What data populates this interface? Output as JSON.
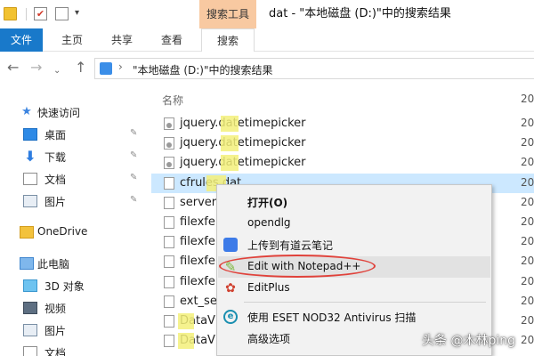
{
  "titlebar": {
    "context_tab": "搜索工具",
    "title": "dat - \"本地磁盘 (D:)\"中的搜索结果",
    "qa_check_glyph": "✔",
    "qa_more_glyph": "▾"
  },
  "ribbon": {
    "tabs": [
      "文件",
      "主页",
      "共享",
      "查看",
      "搜索"
    ]
  },
  "address": {
    "path": "\"本地磁盘 (D:)\"中的搜索结果",
    "nav_back_glyph": "←",
    "nav_forward_glyph": "→",
    "nav_history_glyph": "⌄",
    "nav_up_glyph": "↑",
    "chevron_glyph": "›"
  },
  "nav": {
    "quick_access": "快速访问",
    "pin_glyph": "✎",
    "star_glyph": "★",
    "download_glyph": "⬇",
    "items": [
      {
        "label": "桌面",
        "icon": "desktop-icon"
      },
      {
        "label": "下载",
        "icon": "download-icon"
      },
      {
        "label": "文档",
        "icon": "document-icon"
      },
      {
        "label": "图片",
        "icon": "picture-icon"
      }
    ],
    "onedrive": "OneDrive",
    "this_pc": "此电脑",
    "pc_items": [
      {
        "label": "3D 对象",
        "icon": "3d-objects-icon"
      },
      {
        "label": "视频",
        "icon": "video-icon"
      },
      {
        "label": "图片",
        "icon": "picture-icon"
      },
      {
        "label": "文档",
        "icon": "document-icon"
      }
    ]
  },
  "filelist": {
    "column_name": "名称",
    "date_peek": [
      "20",
      "20",
      "20",
      "20",
      "20",
      "20",
      "20",
      "20",
      "20",
      "20",
      "20",
      "20"
    ],
    "files": [
      {
        "name": "jquery.datetimepicker",
        "icon": "settings-file-icon"
      },
      {
        "name": "jquery.datetimepicker",
        "icon": "settings-file-icon"
      },
      {
        "name": "jquery.datetimepicker",
        "icon": "settings-file-icon"
      },
      {
        "name": "cfrules.dat",
        "icon": "file-icon",
        "selected": true
      },
      {
        "name": "server",
        "icon": "file-icon"
      },
      {
        "name": "filexfe",
        "icon": "file-icon"
      },
      {
        "name": "filexfe",
        "icon": "file-icon"
      },
      {
        "name": "filexfe",
        "icon": "file-icon"
      },
      {
        "name": "filexfe",
        "icon": "file-icon"
      },
      {
        "name": "ext_se",
        "icon": "file-icon"
      },
      {
        "name": "DataV",
        "icon": "file-icon"
      },
      {
        "name": "DataV",
        "icon": "file-icon"
      }
    ]
  },
  "context_menu": {
    "items": [
      {
        "label": "打开(O)"
      },
      {
        "label": "opendlg"
      },
      {
        "label": "上传到有道云笔记",
        "icon": "youdao-note-icon"
      },
      {
        "label": "Edit with Notepad++",
        "icon": "notepadpp-icon",
        "icon_glyph": "✎",
        "highlighted": true
      },
      {
        "label": "EditPlus",
        "icon": "editplus-icon",
        "icon_glyph": "✿"
      },
      {
        "label": "使用 ESET NOD32 Antivirus 扫描",
        "icon": "eset-icon",
        "icon_glyph": "e"
      },
      {
        "label": "高级选项"
      }
    ]
  },
  "watermark": "头条 @木林ping",
  "colors": {
    "accent": "#1979ca",
    "context_tab": "#f8c9a1",
    "selection": "#cce8ff",
    "highlight": "#f3f07a",
    "annotation": "#e0423b"
  }
}
